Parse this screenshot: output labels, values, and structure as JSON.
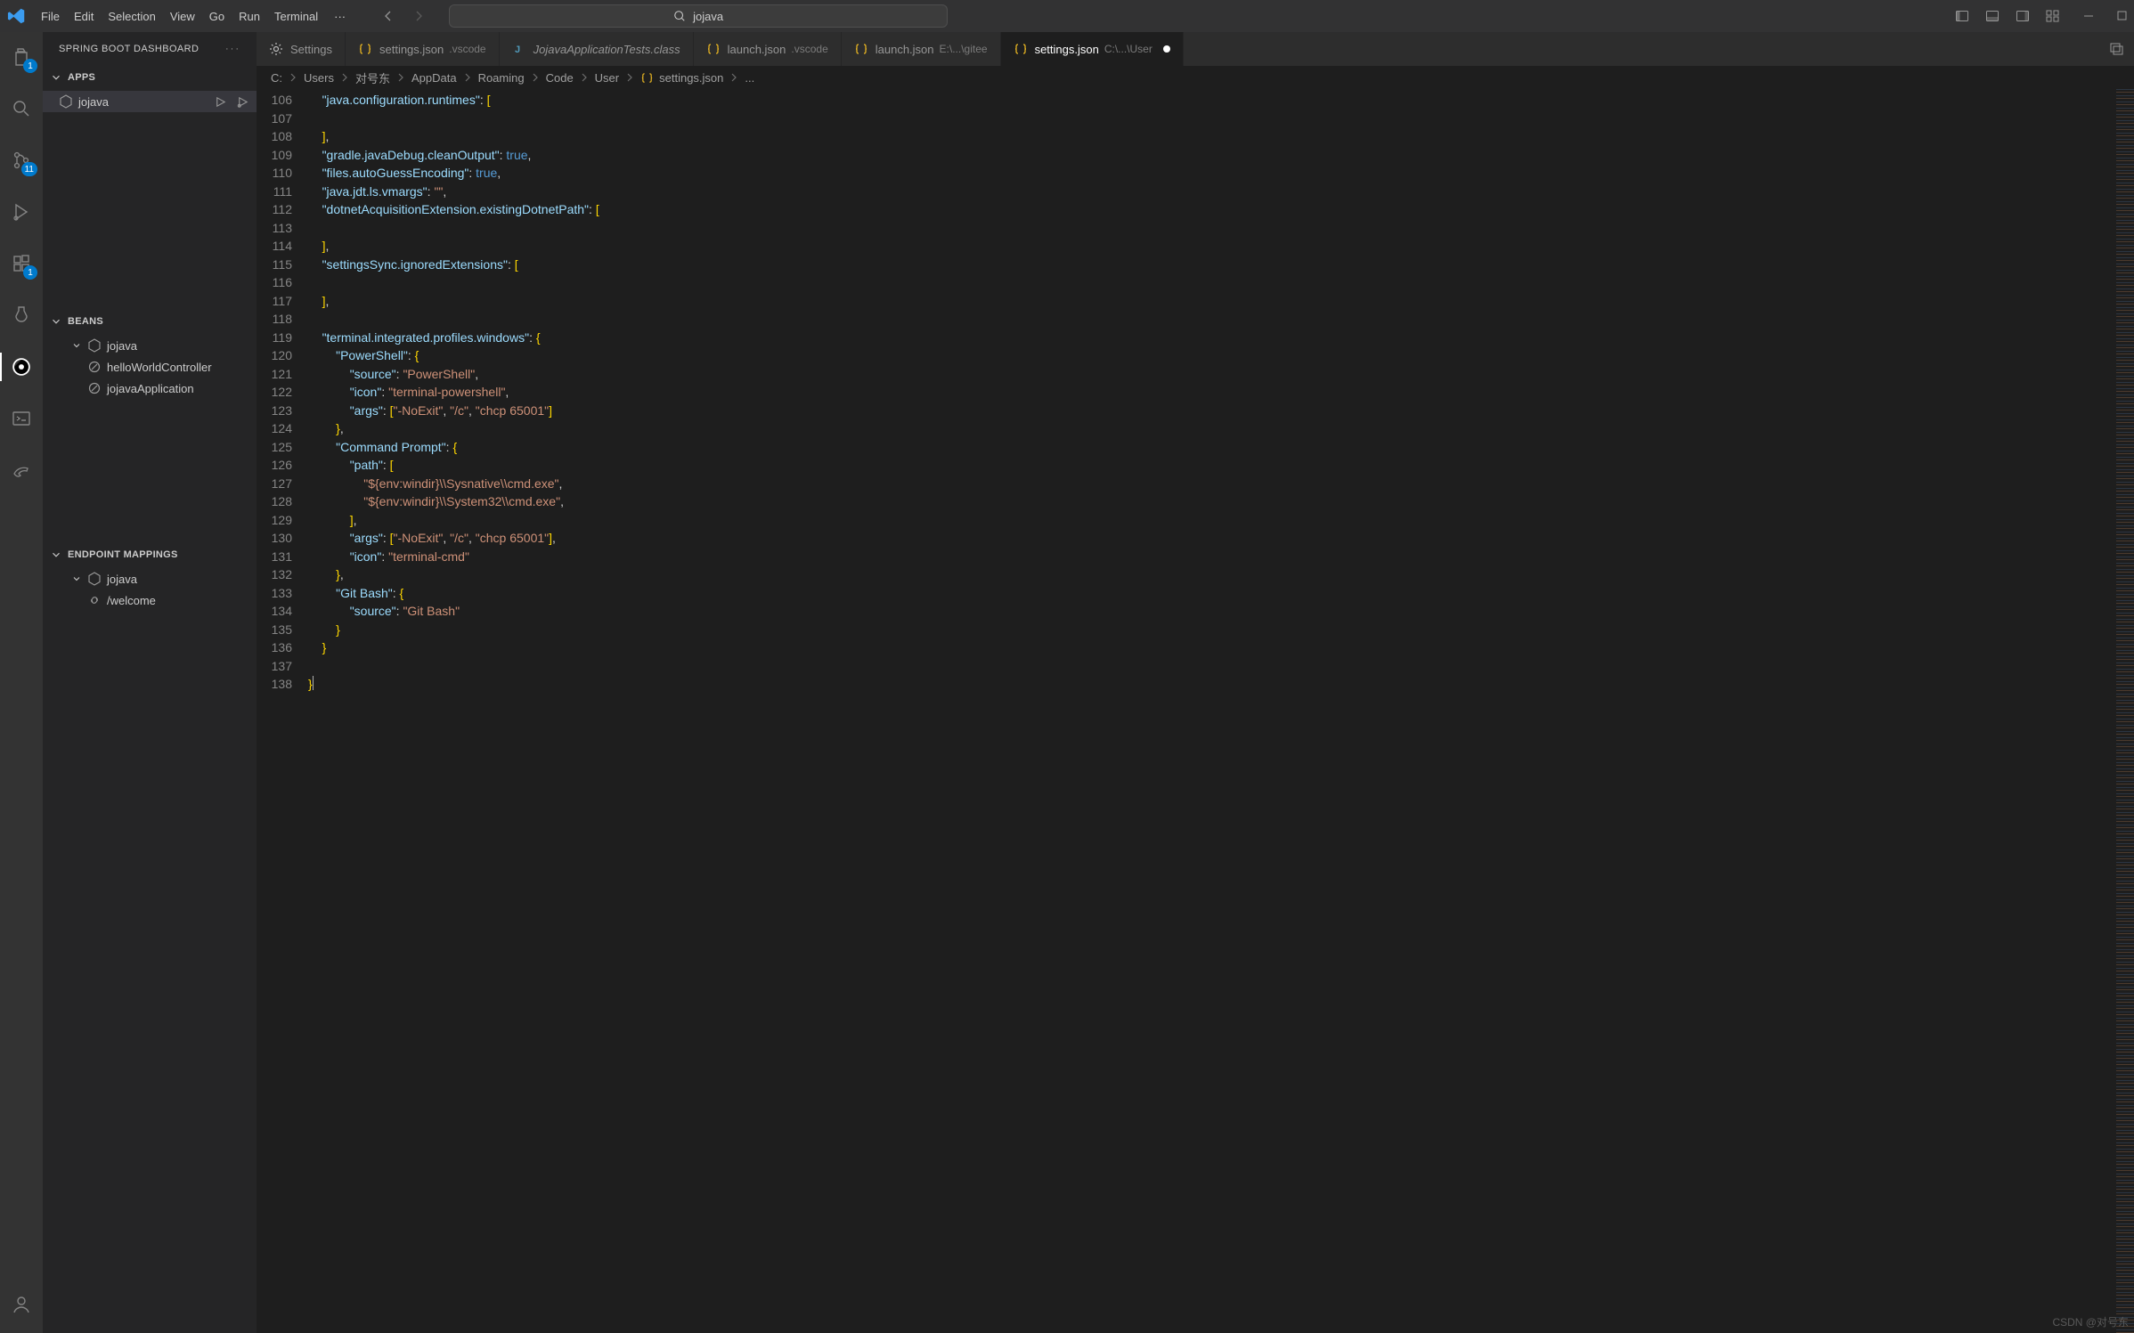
{
  "menu": [
    "File",
    "Edit",
    "Selection",
    "View",
    "Go",
    "Run",
    "Terminal"
  ],
  "search_text": "jojava",
  "sidebar_title": "SPRING BOOT DASHBOARD",
  "panels": {
    "apps": {
      "title": "APPS",
      "items": [
        {
          "label": "jojava"
        }
      ]
    },
    "beans": {
      "title": "BEANS",
      "project": "jojava",
      "items": [
        {
          "label": "helloWorldController"
        },
        {
          "label": "jojavaApplication"
        }
      ]
    },
    "endpoints": {
      "title": "ENDPOINT MAPPINGS",
      "project": "jojava",
      "items": [
        {
          "label": "/welcome"
        }
      ]
    }
  },
  "activity_badges": {
    "explorer": "1",
    "scm": "11",
    "debug_badge": "1"
  },
  "tabs": [
    {
      "icon": "gear",
      "label": "Settings",
      "desc": "",
      "active": false,
      "italic": false
    },
    {
      "icon": "braces",
      "label": "settings.json",
      "desc": ".vscode",
      "active": false,
      "italic": false,
      "icon_color": "#e6b422"
    },
    {
      "icon": "java",
      "label": "JojavaApplicationTests.class",
      "desc": "",
      "active": false,
      "italic": true,
      "icon_color": "#519aba"
    },
    {
      "icon": "braces",
      "label": "launch.json",
      "desc": ".vscode",
      "active": false,
      "italic": false,
      "icon_color": "#e6b422"
    },
    {
      "icon": "braces",
      "label": "launch.json",
      "desc": "E:\\...\\gitee",
      "active": false,
      "italic": false,
      "icon_color": "#e6b422"
    },
    {
      "icon": "braces",
      "label": "settings.json",
      "desc": "C:\\...\\User",
      "active": true,
      "italic": false,
      "icon_color": "#e6b422",
      "dirty": true
    }
  ],
  "breadcrumbs": [
    "C:",
    "Users",
    "对号东",
    "AppData",
    "Roaming",
    "Code",
    "User",
    "settings.json",
    "..."
  ],
  "line_start": 106,
  "line_end": 138,
  "code_lines": [
    {
      "n": 106,
      "t": "    <k>\"java.configuration.runtimes\"</k><p>: </p><y>[</y>"
    },
    {
      "n": 107,
      "t": ""
    },
    {
      "n": 108,
      "t": "    <y>]</y><p>,</p>"
    },
    {
      "n": 109,
      "t": "    <k>\"gradle.javaDebug.cleanOutput\"</k><p>: </p><b>true</b><p>,</p>"
    },
    {
      "n": 110,
      "t": "    <k>\"files.autoGuessEncoding\"</k><p>: </p><b>true</b><p>,</p>"
    },
    {
      "n": 111,
      "t": "    <k>\"java.jdt.ls.vmargs\"</k><p>: </p><s>\"\"</s><p>,</p>"
    },
    {
      "n": 112,
      "t": "    <k>\"dotnetAcquisitionExtension.existingDotnetPath\"</k><p>: </p><y>[</y>"
    },
    {
      "n": 113,
      "t": ""
    },
    {
      "n": 114,
      "t": "    <y>]</y><p>,</p>"
    },
    {
      "n": 115,
      "t": "    <k>\"settingsSync.ignoredExtensions\"</k><p>: </p><y>[</y>"
    },
    {
      "n": 116,
      "t": ""
    },
    {
      "n": 117,
      "t": "    <y>]</y><p>,</p>"
    },
    {
      "n": 118,
      "t": ""
    },
    {
      "n": 119,
      "t": "    <k>\"terminal.integrated.profiles.windows\"</k><p>: </p><y>{</y>"
    },
    {
      "n": 120,
      "t": "        <k>\"PowerShell\"</k><p>: </p><y>{</y>"
    },
    {
      "n": 121,
      "t": "            <k>\"source\"</k><p>: </p><s>\"PowerShell\"</s><p>,</p>"
    },
    {
      "n": 122,
      "t": "            <k>\"icon\"</k><p>: </p><s>\"terminal-powershell\"</s><p>,</p>"
    },
    {
      "n": 123,
      "t": "            <k>\"args\"</k><p>: </p><y>[</y><s>\"-NoExit\"</s><p>, </p><s>\"/c\"</s><p>, </p><s>\"chcp 65001\"</s><y>]</y>"
    },
    {
      "n": 124,
      "t": "        <y>}</y><p>,</p>"
    },
    {
      "n": 125,
      "t": "        <k>\"Command Prompt\"</k><p>: </p><y>{</y>"
    },
    {
      "n": 126,
      "t": "            <k>\"path\"</k><p>: </p><y>[</y>"
    },
    {
      "n": 127,
      "t": "                <s>\"${env:windir}\\\\Sysnative\\\\cmd.exe\"</s><p>,</p>"
    },
    {
      "n": 128,
      "t": "                <s>\"${env:windir}\\\\System32\\\\cmd.exe\"</s><p>,</p>"
    },
    {
      "n": 129,
      "t": "            <y>]</y><p>,</p>"
    },
    {
      "n": 130,
      "t": "            <k>\"args\"</k><p>: </p><y>[</y><s>\"-NoExit\"</s><p>, </p><s>\"/c\"</s><p>, </p><s>\"chcp 65001\"</s><y>]</y><p>,</p>"
    },
    {
      "n": 131,
      "t": "            <k>\"icon\"</k><p>: </p><s>\"terminal-cmd\"</s>"
    },
    {
      "n": 132,
      "t": "        <y>}</y><p>,</p>"
    },
    {
      "n": 133,
      "t": "        <k>\"Git Bash\"</k><p>: </p><y>{</y>"
    },
    {
      "n": 134,
      "t": "            <k>\"source\"</k><p>: </p><s>\"Git Bash\"</s>"
    },
    {
      "n": 135,
      "t": "        <y>}</y>"
    },
    {
      "n": 136,
      "t": "    <y>}</y>"
    },
    {
      "n": 137,
      "t": ""
    },
    {
      "n": 138,
      "t": "<y>}</y><cursor></cursor>"
    }
  ],
  "watermark": "CSDN @对号东"
}
